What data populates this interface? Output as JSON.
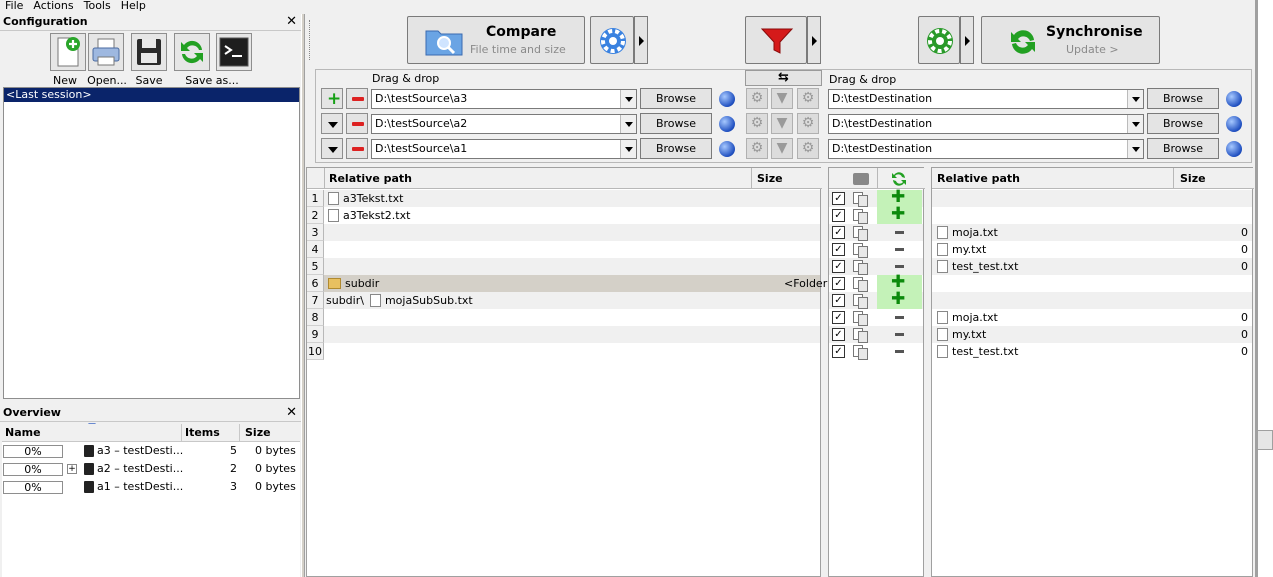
{
  "menu": [
    "File",
    "Actions",
    "Tools",
    "Help"
  ],
  "config": {
    "title": "Configuration",
    "buttons": [
      {
        "label": "New"
      },
      {
        "label": "Open..."
      },
      {
        "label": "Save"
      },
      {
        "label": "Save as..."
      }
    ],
    "session": "<Last session>"
  },
  "overview": {
    "title": "Overview",
    "columns": [
      "Name",
      "Items",
      "Size"
    ],
    "rows": [
      {
        "pct": "0%",
        "name": "a3 – testDesti...",
        "items": "5",
        "size": "0 bytes",
        "expand": ""
      },
      {
        "pct": "0%",
        "name": "a2 – testDesti...",
        "items": "2",
        "size": "0 bytes",
        "expand": "+"
      },
      {
        "pct": "0%",
        "name": "a1 – testDesti...",
        "items": "3",
        "size": "0 bytes",
        "expand": ""
      }
    ]
  },
  "toolbar": {
    "compare": {
      "title": "Compare",
      "subtitle": "File time and size"
    },
    "sync": {
      "title": "Synchronise",
      "subtitle": "Update >"
    },
    "swap_glyph": "⇆"
  },
  "folders": {
    "left_label": "Drag & drop",
    "right_label": "Drag & drop",
    "browse": "Browse",
    "pairs": [
      {
        "left": "D:\\testSource\\a3",
        "right": "D:\\testDestination"
      },
      {
        "left": "D:\\testSource\\a2",
        "right": "D:\\testDestination"
      },
      {
        "left": "D:\\testSource\\a1",
        "right": "D:\\testDestination"
      }
    ]
  },
  "grid": {
    "left_columns": [
      "Relative path",
      "Size"
    ],
    "right_columns": [
      "Relative path",
      "Size"
    ],
    "rows": [
      {
        "n": "1",
        "left_prefix": "",
        "left": "a3Tekst.txt",
        "left_type": "file",
        "left_size": "",
        "action": "copy-right",
        "right": "",
        "right_size": ""
      },
      {
        "n": "2",
        "left_prefix": "",
        "left": "a3Tekst2.txt",
        "left_type": "file",
        "left_size": "",
        "action": "copy-right",
        "right": "",
        "right_size": ""
      },
      {
        "n": "3",
        "left_prefix": "",
        "left": "",
        "left_type": "",
        "left_size": "",
        "action": "delete",
        "right": "moja.txt",
        "right_size": "0"
      },
      {
        "n": "4",
        "left_prefix": "",
        "left": "",
        "left_type": "",
        "left_size": "",
        "action": "delete",
        "right": "my.txt",
        "right_size": "0"
      },
      {
        "n": "5",
        "left_prefix": "",
        "left": "",
        "left_type": "",
        "left_size": "",
        "action": "delete",
        "right": "test_test.txt",
        "right_size": "0"
      },
      {
        "n": "6",
        "left_prefix": "",
        "left": "subdir",
        "left_type": "folder",
        "left_size": "<Folder",
        "action": "copy-right",
        "right": "",
        "right_size": ""
      },
      {
        "n": "7",
        "left_prefix": "subdir\\",
        "left": "mojaSubSub.txt",
        "left_type": "file",
        "left_size": "",
        "action": "copy-right",
        "right": "",
        "right_size": ""
      },
      {
        "n": "8",
        "left_prefix": "",
        "left": "",
        "left_type": "",
        "left_size": "",
        "action": "delete",
        "right": "moja.txt",
        "right_size": "0"
      },
      {
        "n": "9",
        "left_prefix": "",
        "left": "",
        "left_type": "",
        "left_size": "",
        "action": "delete",
        "right": "my.txt",
        "right_size": "0"
      },
      {
        "n": "10",
        "left_prefix": "",
        "left": "",
        "left_type": "",
        "left_size": "",
        "action": "delete",
        "right": "test_test.txt",
        "right_size": "0"
      }
    ]
  },
  "colors": {
    "accent": "#0a246a",
    "action_green": "#c4f2b8"
  }
}
